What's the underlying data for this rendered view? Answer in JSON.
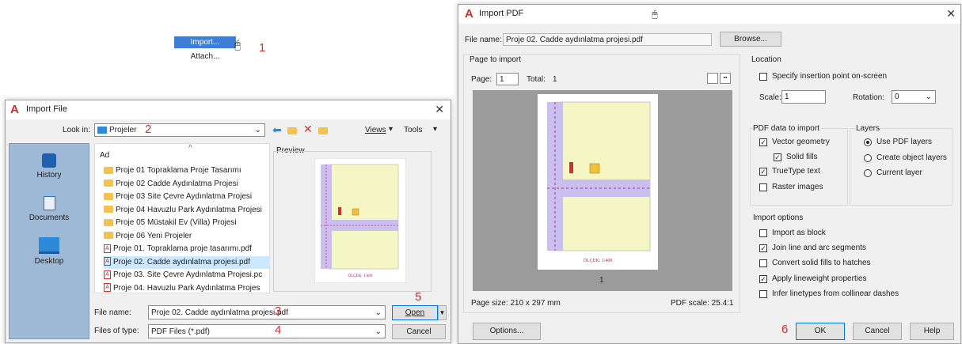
{
  "context_menu": {
    "import": "Import...",
    "attach": "Attach...",
    "step": "1"
  },
  "import_file": {
    "title": "Import File",
    "look_in_label": "Look in:",
    "look_in_value": "Projeler",
    "step_look_in": "2",
    "toolbar": {
      "views": "Views",
      "tools": "Tools"
    },
    "places": [
      "History",
      "Documents",
      "Desktop"
    ],
    "column_header": "Ad",
    "preview_label": "Preview",
    "files": [
      {
        "name": "Proje 01 Topraklama Proje Tasarımı",
        "type": "folder"
      },
      {
        "name": "Proje 02 Cadde Aydınlatma Projesi",
        "type": "folder"
      },
      {
        "name": "Proje 03 Site Çevre Aydınlatma Projesi",
        "type": "folder"
      },
      {
        "name": "Proje 04 Havuzlu Park Aydınlatma Projesi",
        "type": "folder"
      },
      {
        "name": "Proje 05 Müstakil Ev (Villa) Projesi",
        "type": "folder"
      },
      {
        "name": "Proje 06 Yeni Projeler",
        "type": "folder"
      },
      {
        "name": "Proje 01. Topraklama proje tasarımı.pdf",
        "type": "pdf"
      },
      {
        "name": "Proje 02. Cadde aydınlatma projesi.pdf",
        "type": "pdf",
        "selected": true
      },
      {
        "name": "Proje 03. Site Çevre Aydınlatma Projesi.pc",
        "type": "pdf"
      },
      {
        "name": "Proje 04. Havuzlu Park Aydınlatma Projes",
        "type": "pdf"
      }
    ],
    "file_name_label": "File name:",
    "file_name_value": "Proje 02. Cadde aydınlatma projesi.pdf",
    "step_file_name": "3",
    "file_type_label": "Files of type:",
    "file_type_value": "PDF Files (*.pdf)",
    "step_file_type": "4",
    "open_label": "Open",
    "step_open": "5",
    "cancel_label": "Cancel"
  },
  "import_pdf": {
    "title": "Import PDF",
    "file_name_label": "File name:",
    "file_name_value": "Proje 02. Cadde aydınlatma projesi.pdf",
    "browse_label": "Browse...",
    "page_to_import_label": "Page to import",
    "page_label": "Page:",
    "page_value": "1",
    "total_label": "Total:",
    "total_value": "1",
    "thumb_page_number": "1",
    "preview_scale_text": "ÖLÇEK: 1/400",
    "page_size_text": "Page size: 210 x 297 mm",
    "pdf_scale_text": "PDF scale: 25.4:1",
    "location": {
      "label": "Location",
      "specify_label": "Specify insertion point on-screen",
      "specify_checked": false,
      "scale_label": "Scale:",
      "scale_value": "1",
      "rotation_label": "Rotation:",
      "rotation_value": "0"
    },
    "pdf_data": {
      "label": "PDF data to import",
      "vector_geometry": "Vector geometry",
      "solid_fills": "Solid fills",
      "truetype_text": "TrueType text",
      "raster_images": "Raster images"
    },
    "layers": {
      "label": "Layers",
      "use_pdf": "Use PDF layers",
      "create_object": "Create object layers",
      "current_layer": "Current layer"
    },
    "import_options": {
      "label": "Import options",
      "import_as_block": "Import as block",
      "join_segments": "Join line and arc segments",
      "convert_fills": "Convert solid fills to hatches",
      "apply_lineweight": "Apply lineweight properties",
      "infer_linetypes": "Infer linetypes from collinear dashes"
    },
    "options_label": "Options...",
    "step_ok": "6",
    "ok_label": "OK",
    "cancel_label": "Cancel",
    "help_label": "Help"
  },
  "colors": {
    "accent": "#d32f2f",
    "selection": "#cce8ff",
    "preview_bg": "#9b9b9b",
    "drawing_fill": "#f4f7c4",
    "road": "#c9c0f0"
  }
}
